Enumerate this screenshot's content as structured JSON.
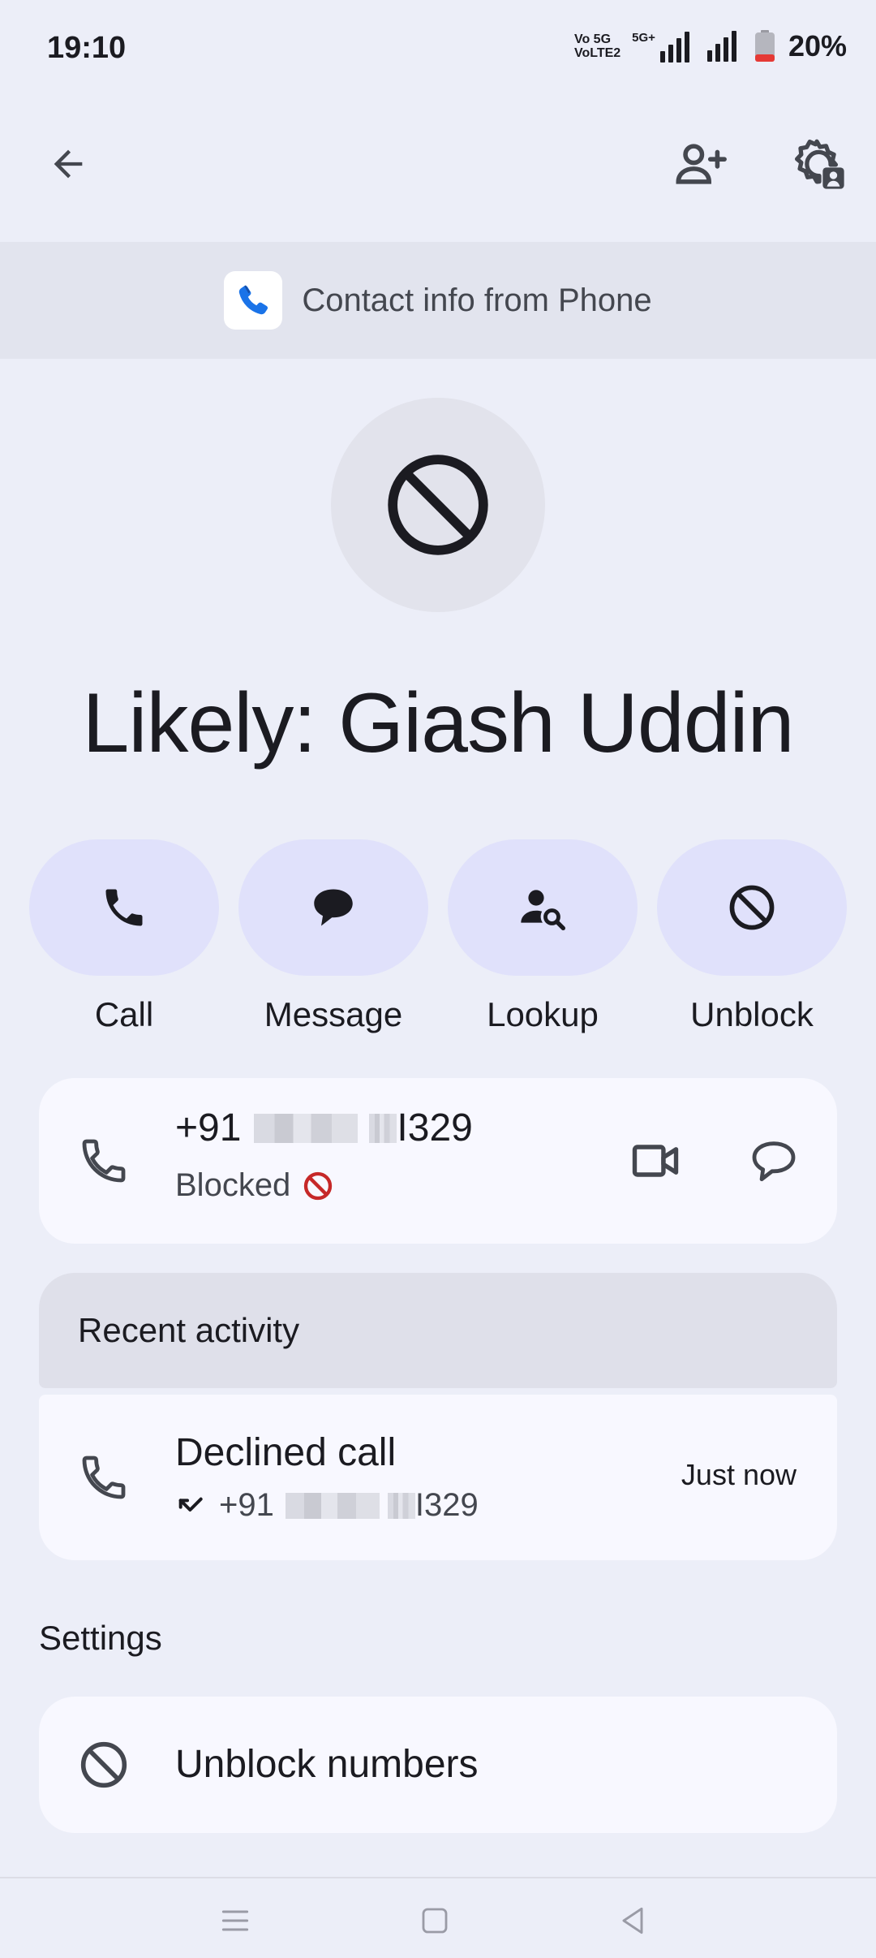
{
  "status_bar": {
    "time": "19:10",
    "network_1": "Vo 5G\nVoLTE2",
    "network_2": "5G+",
    "battery_percent": "20%",
    "battery_level": 0.2
  },
  "app_bar": {
    "back_icon": "arrow-back-icon",
    "add_contact_icon": "person-add-icon",
    "settings_icon": "contact-settings-icon"
  },
  "banner": {
    "text": "Contact info from Phone",
    "icon": "phone-app-logo-icon"
  },
  "contact": {
    "name": "Likely: Giash Uddin",
    "avatar_icon": "blocked-icon"
  },
  "actions": [
    {
      "label": "Call",
      "icon": "phone-icon"
    },
    {
      "label": "Message",
      "icon": "message-icon"
    },
    {
      "label": "Lookup",
      "icon": "person-search-icon"
    },
    {
      "label": "Unblock",
      "icon": "block-icon"
    }
  ],
  "phone_entry": {
    "prefix": "+91",
    "suffix": "I329",
    "status": "Blocked",
    "status_color": "#c62828"
  },
  "recent_activity": {
    "header": "Recent activity",
    "title": "Declined call",
    "number_prefix": "+91",
    "number_suffix": "I329",
    "time": "Just now"
  },
  "settings": {
    "title": "Settings",
    "item_label": "Unblock numbers"
  },
  "colors": {
    "background": "#eceef8",
    "card": "#f8f8ff",
    "action_pill": "#e0e1fb",
    "accent_blue": "#1a73e8"
  }
}
